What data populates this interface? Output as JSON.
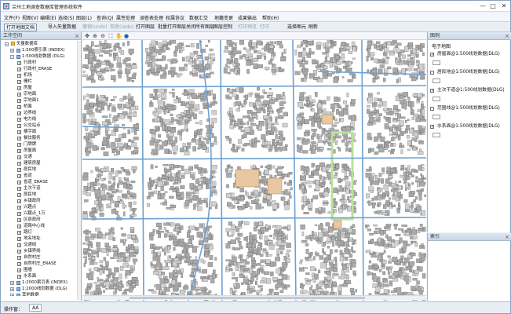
{
  "window": {
    "title": "兰州土地调查数据库管理系统软件",
    "minimize_glyph": "—",
    "maximize_glyph": "□",
    "close_glyph": "✕"
  },
  "menu": {
    "items": [
      "文件(F)",
      "视图(V)",
      "编辑(E)",
      "选择(S)",
      "图层(L)",
      "查询(Q)",
      "属性处理",
      "调查表处理",
      "权属协议",
      "数据汇交",
      "地籍变更",
      "成果输出",
      "帮助(H)"
    ]
  },
  "toolbar": {
    "items": [
      {
        "label": "打开地图文档",
        "disabled": false,
        "boxed": true
      },
      {
        "label": "导入矢量数据",
        "disabled": false,
        "boxed": false
      },
      {
        "label": "撤销(undo)",
        "disabled": true,
        "boxed": false
      },
      {
        "label": "恢复(redo)",
        "disabled": true,
        "boxed": false
      },
      {
        "label": "打开图层",
        "disabled": false,
        "boxed": false
      },
      {
        "label": "批量打开图层",
        "disabled": false,
        "boxed": false
      },
      {
        "label": "关闭所有图层",
        "disabled": false,
        "boxed": false
      },
      {
        "label": "图层控制",
        "disabled": false,
        "boxed": false
      },
      {
        "label": "打印预览",
        "disabled": true,
        "boxed": false
      },
      {
        "label": "打印",
        "disabled": true,
        "boxed": false
      },
      {
        "label": "选择图元",
        "disabled": false,
        "boxed": false
      },
      {
        "label": "刷新",
        "disabled": false,
        "boxed": false
      }
    ]
  },
  "workspace": {
    "title": "工作空间",
    "tree": [
      {
        "level": 0,
        "label": "矢量数据库",
        "expander": "-",
        "checkbox": null
      },
      {
        "level": 1,
        "label": "1:500索引表 (INDEX)",
        "expander": "+",
        "checkbox": null
      },
      {
        "level": 1,
        "label": "1:500线划数据 (DLG)",
        "expander": "-",
        "checkbox": null
      },
      {
        "level": 2,
        "label": "行政村",
        "checkbox": "checked"
      },
      {
        "level": 2,
        "label": "行政村_ERASE",
        "checkbox": "checked"
      },
      {
        "level": 2,
        "label": "机场",
        "checkbox": "checked"
      },
      {
        "level": 2,
        "label": "栅栏",
        "checkbox": "checked"
      },
      {
        "level": 2,
        "label": "房屋",
        "checkbox": "checked"
      },
      {
        "level": 2,
        "label": "宗地面",
        "checkbox": "checked"
      },
      {
        "level": 2,
        "label": "宗地面1",
        "checkbox": "checked"
      },
      {
        "level": 2,
        "label": "桥面",
        "checkbox": "checked"
      },
      {
        "level": 2,
        "label": "边界线",
        "checkbox": "checked"
      },
      {
        "level": 2,
        "label": "电力线",
        "checkbox": "checked"
      },
      {
        "level": 2,
        "label": "公交站点",
        "checkbox": "checked"
      },
      {
        "level": 2,
        "label": "楼宇面",
        "checkbox": "checked"
      },
      {
        "level": 2,
        "label": "餐饮服务",
        "checkbox": "checked"
      },
      {
        "level": 2,
        "label": "门牌牌",
        "checkbox": "checked"
      },
      {
        "level": 2,
        "label": "房屋面",
        "checkbox": "checked"
      },
      {
        "level": 2,
        "label": "交通",
        "checkbox": "checked"
      },
      {
        "level": 2,
        "label": "建筑房屋",
        "checkbox": "checked"
      },
      {
        "level": 2,
        "label": "居民地",
        "checkbox": "checked"
      },
      {
        "level": 2,
        "label": "省道",
        "checkbox": "checked"
      },
      {
        "level": 2,
        "label": "省道_ERASE",
        "checkbox": "checked"
      },
      {
        "level": 2,
        "label": "主次干道",
        "checkbox": "checked"
      },
      {
        "level": 2,
        "label": "居民地",
        "checkbox": "checked"
      },
      {
        "level": 2,
        "label": "乡镇政府",
        "checkbox": "checked"
      },
      {
        "level": 2,
        "label": "兴趣点",
        "checkbox": "checked"
      },
      {
        "level": 2,
        "label": "兴趣点_1万",
        "checkbox": "checked"
      },
      {
        "level": 2,
        "label": "区县政府",
        "checkbox": "checked"
      },
      {
        "level": 2,
        "label": "道路中心线",
        "checkbox": "checked"
      },
      {
        "level": 2,
        "label": "路灯",
        "checkbox": "checked"
      },
      {
        "level": 2,
        "label": "地名地址",
        "checkbox": "checked"
      },
      {
        "level": 2,
        "label": "交通线",
        "checkbox": "checked"
      },
      {
        "level": 2,
        "label": "乡镇界线",
        "checkbox": "checked"
      },
      {
        "level": 2,
        "label": "自然村庄",
        "checkbox": "checked"
      },
      {
        "level": 2,
        "label": "自然村庄_ERASE",
        "checkbox": "checked"
      },
      {
        "level": 2,
        "label": "围墙",
        "checkbox": "checked"
      },
      {
        "level": 2,
        "label": "水系面",
        "checkbox": "checked"
      },
      {
        "level": 1,
        "label": "1:2000索引表 (INDEX)",
        "expander": "+",
        "checkbox": null
      },
      {
        "level": 1,
        "label": "1:2000线划数据 (DLG)",
        "expander": "+",
        "checkbox": null
      },
      {
        "level": 1,
        "label": "其他数据",
        "expander": "+",
        "checkbox": null
      }
    ]
  },
  "layers": {
    "title": "图例",
    "group": "电子地图",
    "items": [
      {
        "label": "房屋面@1:500线划数据(DLG)",
        "checked": true
      },
      {
        "label": "居民地@1:500线划数据(DLG)",
        "checked": false
      },
      {
        "label": "主次干道@1:500线划数据(DLG)",
        "checked": true
      },
      {
        "label": "范围线@1:500线划数据(DLG)",
        "checked": false
      },
      {
        "label": "水系面@1:500线划数据(DLG)",
        "checked": true
      }
    ]
  },
  "index_panel": {
    "title": "索引"
  },
  "status": {
    "label": "操作窗：",
    "tab": "AA"
  },
  "colors": {
    "road": "#6fa0cf",
    "building": "#a9a9a9",
    "highlight_green": "#b8e39a",
    "plot": "#e9c7a0"
  },
  "icons": {
    "app": "app-logo-icon",
    "map_tools": [
      "pan-icon",
      "zoom-in-icon",
      "zoom-out-icon",
      "full-extent-icon",
      "hand-icon",
      "globe-icon"
    ]
  }
}
